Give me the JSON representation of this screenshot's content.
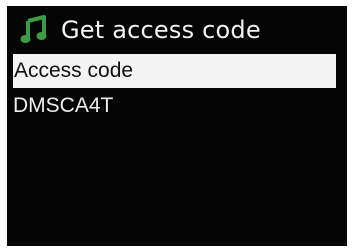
{
  "app": {
    "icon": "music-note-icon",
    "accent_color": "#3e9b45"
  },
  "header": {
    "title": "Get access code"
  },
  "menu": {
    "selected_item": "Access code",
    "items": [
      {
        "label": "Access code"
      },
      {
        "label": "DMSCA4T"
      }
    ]
  }
}
